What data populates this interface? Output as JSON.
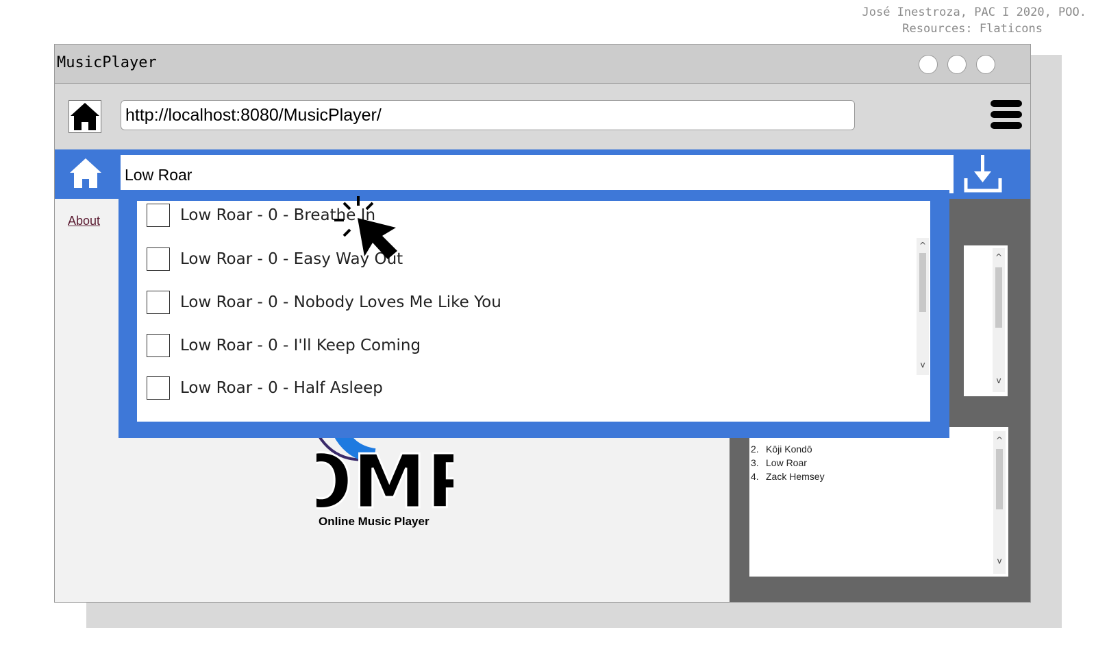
{
  "credit": {
    "line1": "José Inestroza, PAC I 2020, POO.",
    "line2": "Resources: Flaticons"
  },
  "window": {
    "title": "MusicPlayer"
  },
  "browser": {
    "url": "http://localhost:8080/MusicPlayer/"
  },
  "search": {
    "value": "Low Roar"
  },
  "sidebar": {
    "about_label": "About"
  },
  "dropdown": {
    "options": [
      "Low Roar - 0 - Breathe In",
      "Low Roar - 0 - Easy Way Out",
      "Low Roar - 0 - Nobody Loves Me Like You",
      "Low Roar - 0 - I'll Keep Coming",
      "Low Roar - 0 - Half Asleep"
    ]
  },
  "artists": {
    "items": [
      {
        "num": "2.",
        "name": "Kōji Kondō"
      },
      {
        "num": "3.",
        "name": "Low Roar"
      },
      {
        "num": "4.",
        "name": "Zack Hemsey"
      }
    ]
  },
  "logo": {
    "text": "OMP",
    "caption": "Online Music Player"
  },
  "colors": {
    "accent_blue": "#3e78d8",
    "panel_gray": "#666666"
  },
  "icons": {
    "addr_home": "home-icon",
    "menu": "hamburger-menu-icon",
    "nav_home": "home-icon",
    "download": "download-icon",
    "cursor": "click-cursor-icon"
  }
}
